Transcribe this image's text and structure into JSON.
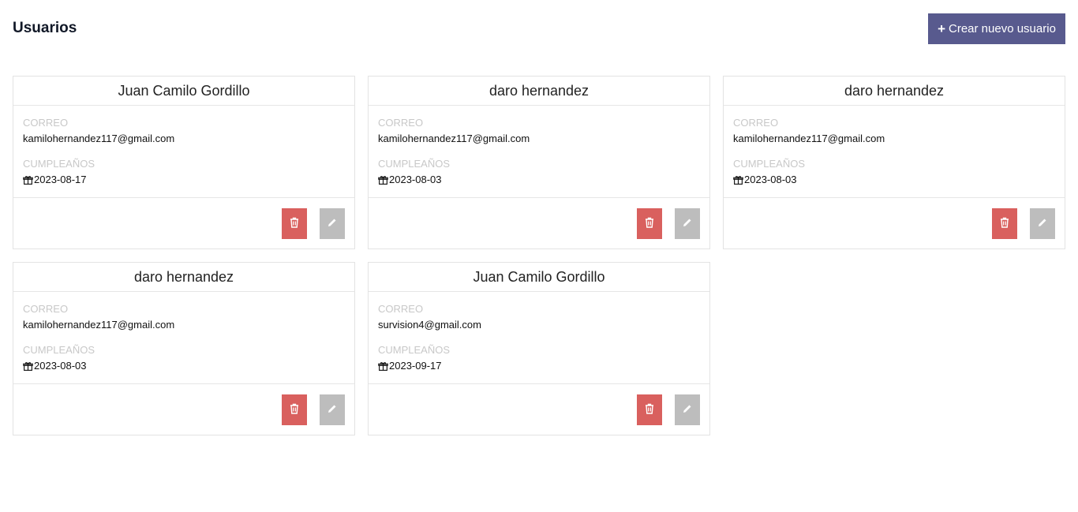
{
  "header": {
    "title": "Usuarios",
    "create_button_label": "Crear nuevo usuario"
  },
  "labels": {
    "email": "CORREO",
    "birthday": "CUMPLEAÑOS"
  },
  "colors": {
    "primary_button": "#585a8e",
    "delete_button": "#d9605e",
    "edit_button": "#bdbdbd"
  },
  "users": [
    {
      "name": "Juan Camilo Gordillo",
      "email": "kamilohernandez117@gmail.com",
      "birthday": "2023-08-17"
    },
    {
      "name": "daro hernandez",
      "email": "kamilohernandez117@gmail.com",
      "birthday": "2023-08-03"
    },
    {
      "name": "daro hernandez",
      "email": "kamilohernandez117@gmail.com",
      "birthday": "2023-08-03"
    },
    {
      "name": "daro hernandez",
      "email": "kamilohernandez117@gmail.com",
      "birthday": "2023-08-03"
    },
    {
      "name": "Juan Camilo Gordillo",
      "email": "survision4@gmail.com",
      "birthday": "2023-09-17"
    }
  ]
}
